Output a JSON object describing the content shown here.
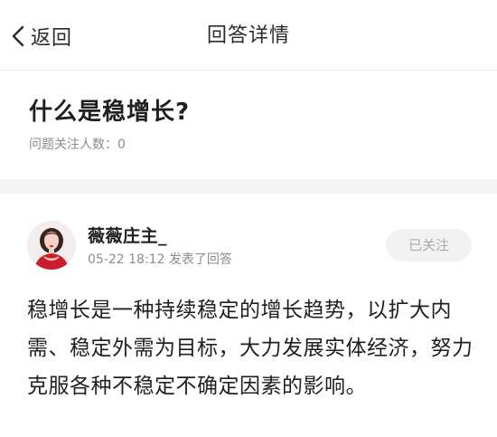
{
  "nav": {
    "back_label": "返回",
    "title": "回答详情"
  },
  "question": {
    "title": "什么是稳增长?",
    "followers_text": "问题关注人数：0"
  },
  "answer": {
    "author_name": "薇薇庄主_",
    "meta_text": "05-22 18:12 发表了回答",
    "follow_label": "已关注",
    "body": "稳增长是一种持续稳定的增长趋势，以扩大内需、稳定外需为目标，大力发展实体经济，努力克服各种不稳定不确定因素的影响。"
  }
}
